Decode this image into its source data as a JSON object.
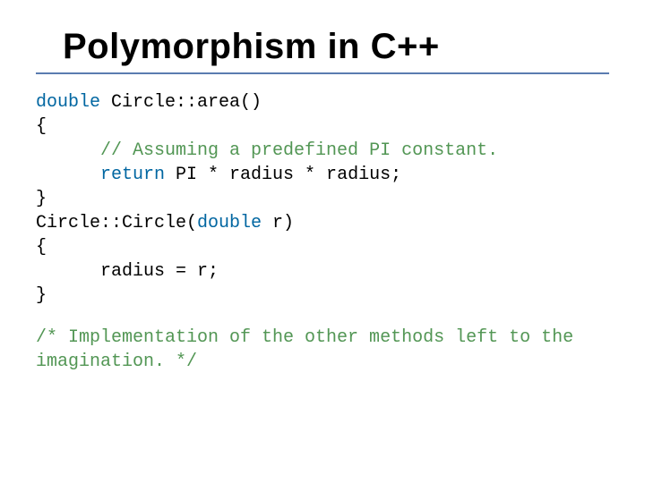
{
  "title": "Polymorphism in C++",
  "code": {
    "l1_kw": "double",
    "l1_rest": " Circle::area()",
    "l2": "{",
    "l3_indent": "      ",
    "l3_cm": "// Assuming a predefined PI constant.",
    "l4_indent": "      ",
    "l4_kw": "return",
    "l4_rest": " PI * radius * radius;",
    "l5": "}",
    "l6_a": "Circle::Circle(",
    "l6_kw": "double",
    "l6_b": " r)",
    "l7": "{",
    "l8_indent": "      ",
    "l8": "radius = r;",
    "l9": "}",
    "l10_cm_a": "/* Implementation of the other methods left to the",
    "l10_cm_b": "imagination. */"
  }
}
